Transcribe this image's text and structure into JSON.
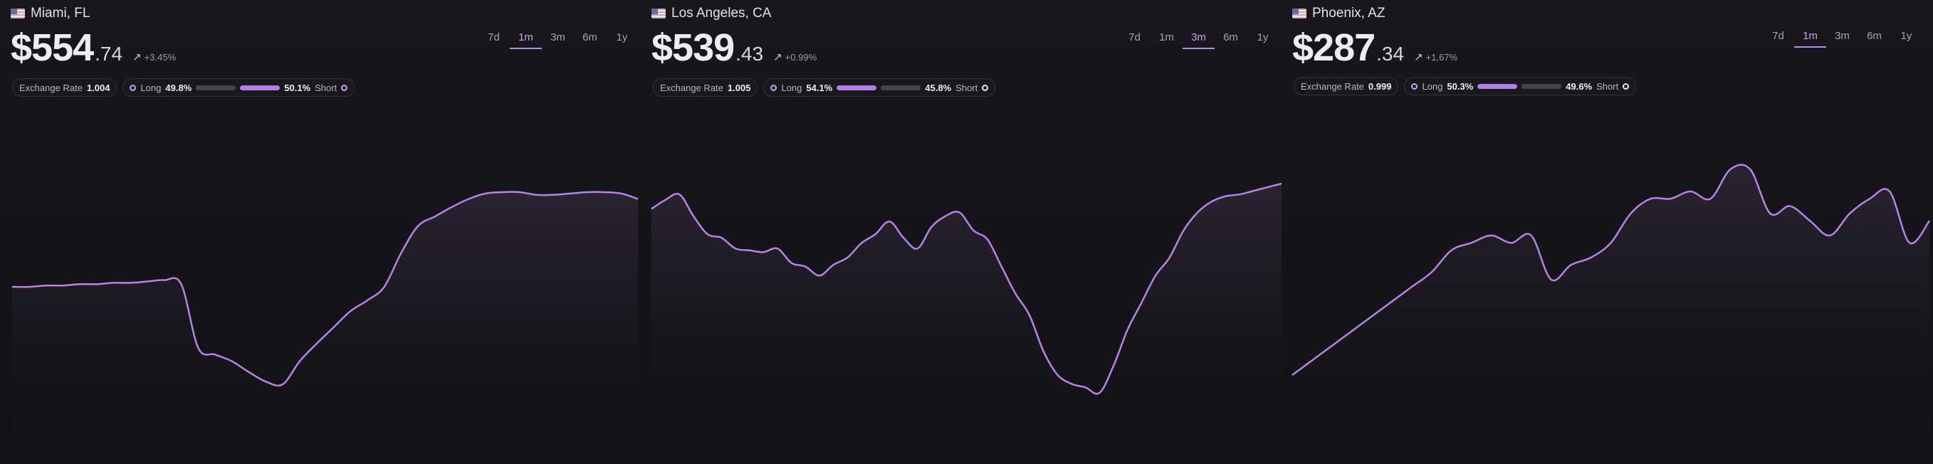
{
  "panels": [
    {
      "flag": "us-flag-icon",
      "city": "Miami, FL",
      "currency": "$",
      "price_int": "554",
      "price_dec": ".74",
      "change": "+3.45%",
      "tabs": [
        "7d",
        "1m",
        "3m",
        "6m",
        "1y"
      ],
      "active_tab": "1m",
      "exchange_label": "Exchange Rate",
      "exchange_value": "1.004",
      "long_label": "Long",
      "long_pct": "49.8%",
      "short_label": "Short",
      "short_pct": "50.1%",
      "long_fraction": 0.498,
      "short_fraction": 0.501,
      "series": [
        555,
        555,
        556,
        556,
        557,
        557,
        558,
        558,
        559,
        560,
        557,
        510,
        505,
        500,
        492,
        485,
        483,
        500,
        513,
        525,
        537,
        545,
        555,
        580,
        600,
        607,
        614,
        620,
        624,
        625,
        625,
        623,
        623,
        624,
        625,
        625,
        624,
        620
      ]
    },
    {
      "flag": "us-flag-icon",
      "city": "Los Angeles, CA",
      "currency": "$",
      "price_int": "539",
      "price_dec": ".43",
      "change": "+0.99%",
      "tabs": [
        "7d",
        "1m",
        "3m",
        "6m",
        "1y"
      ],
      "active_tab": "3m",
      "exchange_label": "Exchange Rate",
      "exchange_value": "1.005",
      "long_label": "Long",
      "long_pct": "54.1%",
      "short_label": "Short",
      "short_pct": "45.8%",
      "long_fraction": 0.541,
      "short_fraction": 0.458,
      "series": [
        612,
        617,
        620,
        608,
        598,
        596,
        590,
        589,
        588,
        590,
        582,
        580,
        575,
        581,
        585,
        593,
        598,
        605,
        596,
        590,
        602,
        608,
        610,
        600,
        595,
        580,
        565,
        553,
        533,
        520,
        515,
        513,
        510,
        525,
        545,
        560,
        575,
        585,
        600,
        610,
        616,
        619,
        620,
        622,
        624,
        626
      ]
    },
    {
      "flag": "us-flag-icon",
      "city": "Phoenix, AZ",
      "currency": "$",
      "price_int": "287",
      "price_dec": ".34",
      "change": "+1.67%",
      "tabs": [
        "7d",
        "1m",
        "3m",
        "6m",
        "1y"
      ],
      "active_tab": "1m",
      "exchange_label": "Exchange Rate",
      "exchange_value": "0.999",
      "long_label": "Long",
      "long_pct": "50.3%",
      "short_label": "Short",
      "short_pct": "49.6%",
      "long_fraction": 0.503,
      "short_fraction": 0.496,
      "series": [
        268,
        270,
        272,
        274,
        276,
        278,
        280,
        282,
        285,
        286,
        287,
        286,
        287,
        281,
        283,
        284,
        286,
        290,
        292,
        292,
        293,
        292,
        296,
        296,
        290,
        291,
        289,
        287,
        290,
        292,
        293,
        286,
        289
      ]
    }
  ],
  "colors": {
    "accent": "#b98ae8",
    "line": "#b784e6",
    "fill_top": "#2b2534",
    "background": "#131216"
  }
}
